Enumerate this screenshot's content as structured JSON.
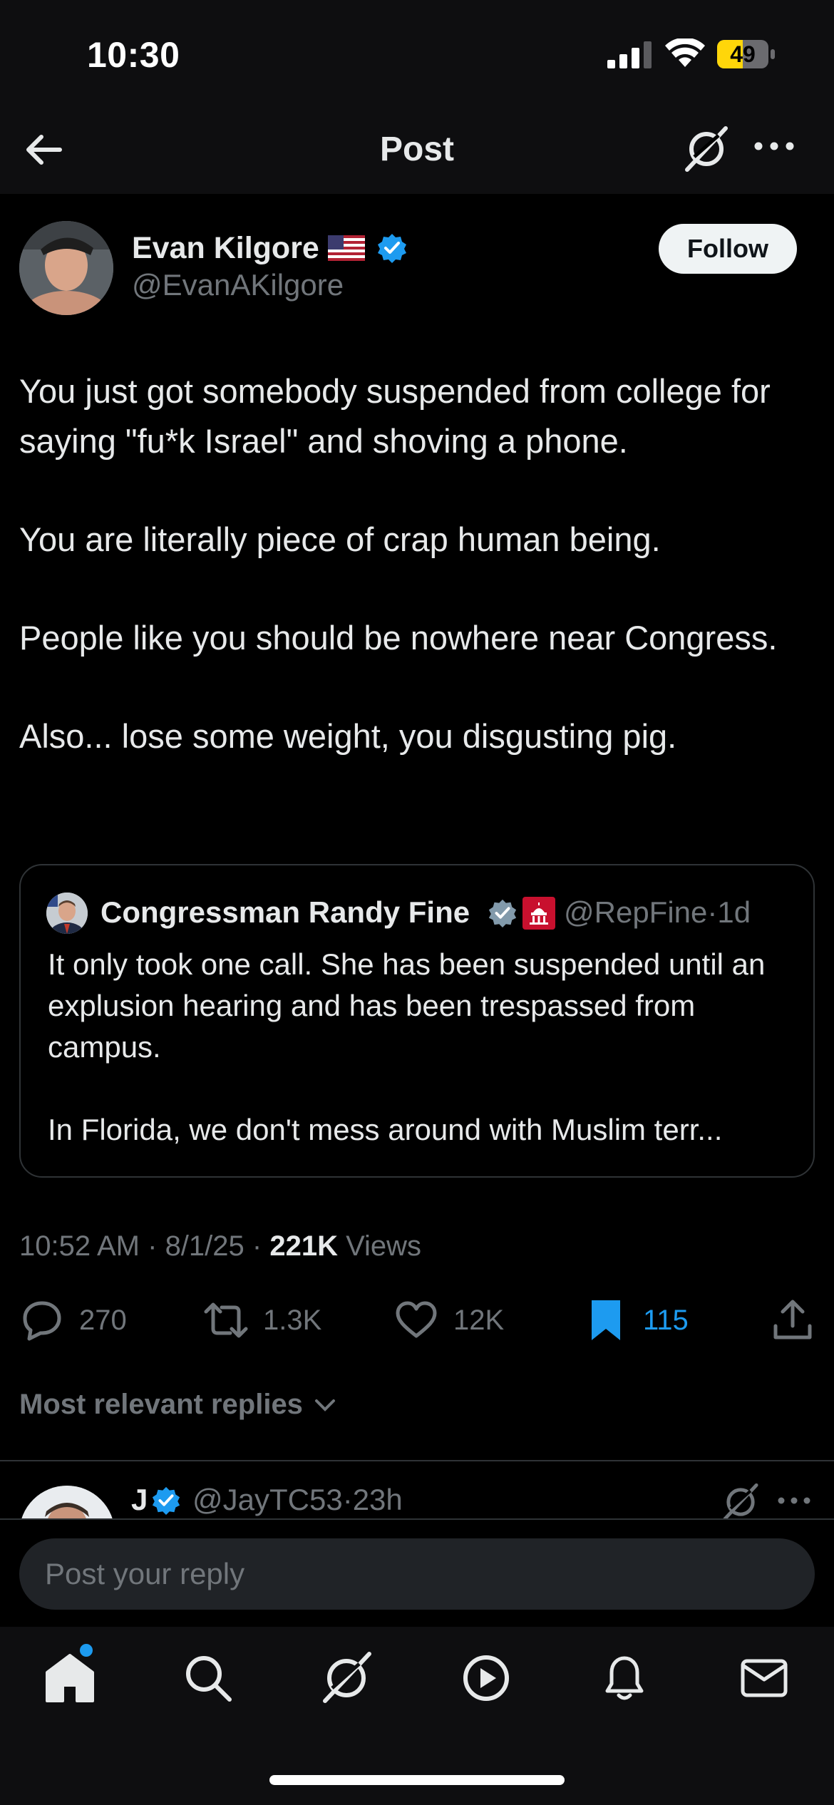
{
  "status_bar": {
    "time": "10:30",
    "battery": "49"
  },
  "header": {
    "title": "Post"
  },
  "post": {
    "author_name": "Evan Kilgore",
    "author_handle": "@EvanAKilgore",
    "follow_label": "Follow",
    "paragraphs": [
      "You just got somebody suspended from college for saying \"fu*k Israel\" and shoving a phone.",
      "You are literally piece of crap human being.",
      "People like you should be nowhere near Congress.",
      "Also... lose some weight, you disgusting pig."
    ],
    "quote": {
      "author_name": "Congressman Randy Fine",
      "author_handle": "@RepFine",
      "age": "1d",
      "paragraphs": [
        "It only took one call.  She has been suspended until an explusion hearing and has been trespassed from campus.",
        "In Florida, we don't mess around with Muslim terr..."
      ]
    },
    "time": "10:52 AM",
    "date": "8/1/25",
    "views_count": "221K",
    "views_label": "Views",
    "stats": {
      "replies": "270",
      "reposts": "1.3K",
      "likes": "12K",
      "bookmarks": "115"
    }
  },
  "replies_filter": "Most relevant replies",
  "reply_preview": {
    "name": "J",
    "handle": "@JayTC53",
    "age": "23h"
  },
  "composer": {
    "placeholder": "Post your reply"
  },
  "colors": {
    "accent": "#1d9bf0",
    "background": "#000000",
    "muted": "#71767b",
    "text": "#e7e9ea"
  },
  "tab_icons": [
    "home-icon",
    "search-icon",
    "grok-icon",
    "video-icon",
    "notifications-icon",
    "messages-icon"
  ]
}
